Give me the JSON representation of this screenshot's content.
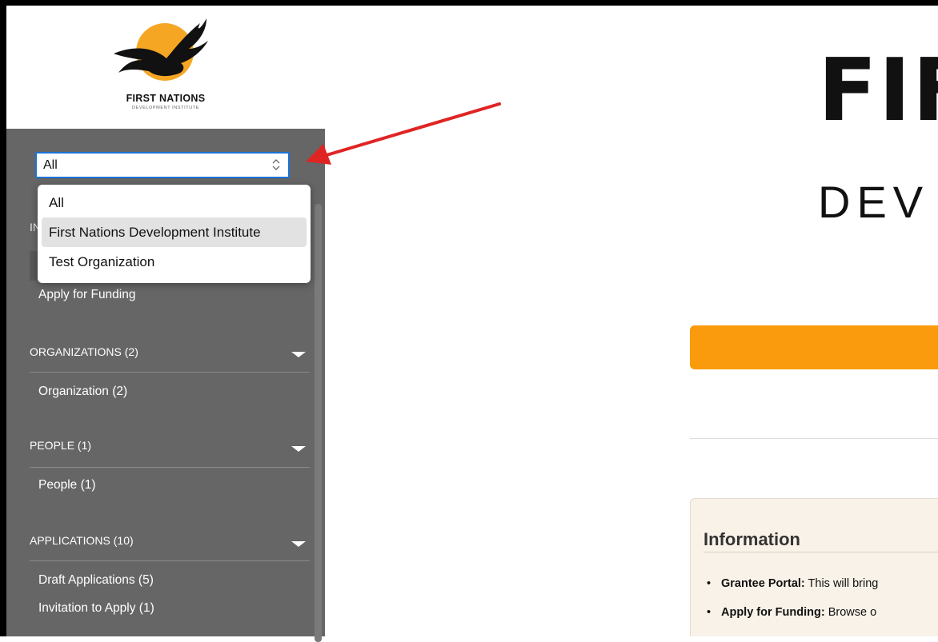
{
  "brand": {
    "logo_title": "FIRST NATIONS",
    "logo_subtitle": "DEVELOPMENT INSTITUTE",
    "headline": "FIF",
    "subheadline": "DEV"
  },
  "org_select": {
    "value": "All",
    "options": [
      "All",
      "First Nations Development Institute",
      "Test Organization"
    ],
    "highlighted_index": 1
  },
  "sidebar": {
    "partial_header": "IN",
    "apply_link": "Apply for Funding",
    "sections": [
      {
        "label": "ORGANIZATIONS (2)",
        "items": [
          "Organization  (2)"
        ]
      },
      {
        "label": "PEOPLE (1)",
        "items": [
          "People  (1)"
        ]
      },
      {
        "label": "APPLICATIONS (10)",
        "items": [
          "Draft Applications  (5)",
          "Invitation to Apply  (1)"
        ]
      }
    ]
  },
  "info": {
    "title": "Information",
    "bullets": [
      {
        "label": "Grantee Portal:",
        "text": " This will bring"
      },
      {
        "label": "Apply for Funding:",
        "text": " Browse o"
      }
    ]
  },
  "colors": {
    "sidebar_bg": "#666666",
    "accent_orange": "#f99b0c",
    "select_border": "#1b72d6",
    "annotation_arrow": "#e02424"
  }
}
